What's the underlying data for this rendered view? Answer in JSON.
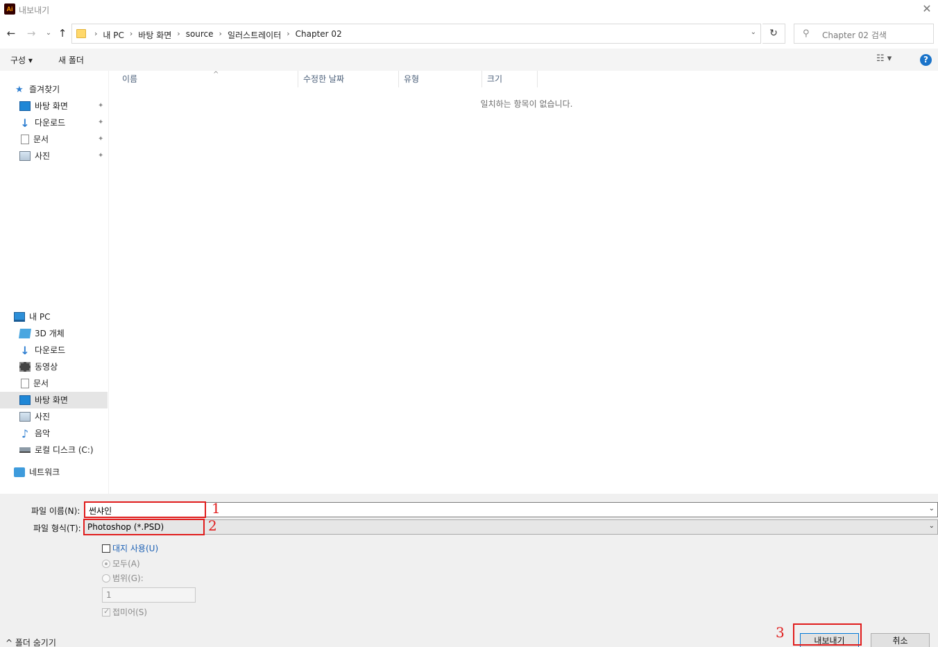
{
  "window": {
    "app_icon_text": "Ai",
    "title": "내보내기",
    "close_glyph": "✕"
  },
  "nav": {
    "back_glyph": "←",
    "forward_glyph": "→",
    "recent_glyph": "⌄",
    "up_glyph": "↑"
  },
  "address": {
    "crumbs": [
      "내 PC",
      "바탕 화면",
      "source",
      "일러스트레이터",
      "Chapter 02"
    ],
    "separator": "›",
    "dropdown_glyph": "⌄",
    "refresh_glyph": "↻"
  },
  "search": {
    "icon_glyph": "⚲",
    "placeholder": "Chapter 02 검색"
  },
  "toolbar": {
    "organize_label": "구성 ▾",
    "new_folder_label": "새 폴더",
    "view_label": "☷ ▾",
    "help_label": "?"
  },
  "sidebar": {
    "quick_access": {
      "label": "즐겨찾기",
      "items": [
        {
          "label": "바탕 화면",
          "icon": "desktop-icon",
          "pinned": true
        },
        {
          "label": "다운로드",
          "icon": "download-icon",
          "pinned": true
        },
        {
          "label": "문서",
          "icon": "document-icon",
          "pinned": true
        },
        {
          "label": "사진",
          "icon": "pictures-icon",
          "pinned": true
        }
      ]
    },
    "pin_glyph": "📌",
    "this_pc": {
      "label": "내 PC",
      "items": [
        {
          "label": "3D 개체",
          "icon": "3d-objects-icon"
        },
        {
          "label": "다운로드",
          "icon": "download-icon"
        },
        {
          "label": "동영상",
          "icon": "video-icon"
        },
        {
          "label": "문서",
          "icon": "document-icon"
        },
        {
          "label": "바탕 화면",
          "icon": "desktop-icon",
          "selected": true
        },
        {
          "label": "사진",
          "icon": "pictures-icon"
        },
        {
          "label": "음악",
          "icon": "music-icon"
        },
        {
          "label": "로컬 디스크 (C:)",
          "icon": "disk-icon"
        }
      ]
    },
    "network": {
      "label": "네트워크"
    }
  },
  "file_list": {
    "columns": [
      "이름",
      "수정한 날짜",
      "유형",
      "크기"
    ],
    "sort_glyph": "^",
    "empty_message": "일치하는 항목이 없습니다."
  },
  "form": {
    "filename_label": "파일 이름(N):",
    "filename_value": "썬샤인",
    "filetype_label": "파일 형식(T):",
    "filetype_value": "Photoshop (*.PSD)",
    "dropdown_glyph": "⌄",
    "use_artboards_label": "대지 사용(U)",
    "all_label": "모두(A)",
    "range_label": "범위(G):",
    "range_value": "1",
    "anti_alias_label": "접미어(S)",
    "check_glyph": "✓"
  },
  "annotations": {
    "marker_1": "1",
    "marker_2": "2",
    "marker_3": "3",
    "color": "#e01b1b"
  },
  "footer": {
    "hide_folders_label": "^  폴더 숨기기",
    "export_button": "내보내기",
    "cancel_button": "취소"
  }
}
